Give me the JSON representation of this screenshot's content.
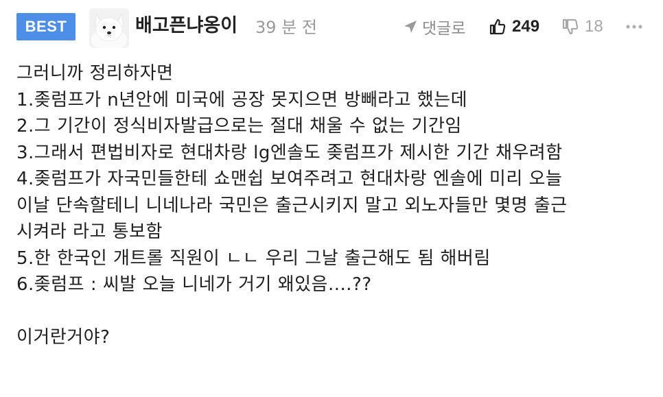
{
  "comment": {
    "badge": "BEST",
    "avatar_icon": "white-dog-avatar",
    "username": "배고픈냐옹이",
    "time": "39 분 전",
    "reply_label": "댓글로",
    "reply_icon": "reply-arrow-icon",
    "likes": "249",
    "like_icon": "thumbs-up-icon",
    "dislikes": "18",
    "dislike_icon": "thumbs-down-icon",
    "more_icon": "more-dots-icon",
    "badge_color": "#4d8fe8",
    "lines": [
      "그러니까 정리하자면",
      "1.좆럼프가 n년안에 미국에 공장 못지으면 방빼라고 했는데",
      "2.그 기간이 정식비자발급으로는 절대 채울 수 없는 기간임",
      "3.그래서 편법비자로 현대차랑 lg엔솔도 좆럼프가 제시한 기간 채우려함",
      "4.좆럼프가 자국민들한테 쇼맨쉽 보여주려고 현대차랑 엔솔에 미리 오늘",
      "이날 단속할테니 니네나라 국민은 출근시키지 말고 외노자들만 몇명 출근",
      "시켜라 라고 통보함",
      "5.한 한국인 개트롤 직원이 ㄴㄴ 우리 그날 출근해도 됨 해버림",
      "6.좆럼프 : 씨발 오늘 니네가 거기 왜있음....??",
      "이거란거야?"
    ]
  }
}
